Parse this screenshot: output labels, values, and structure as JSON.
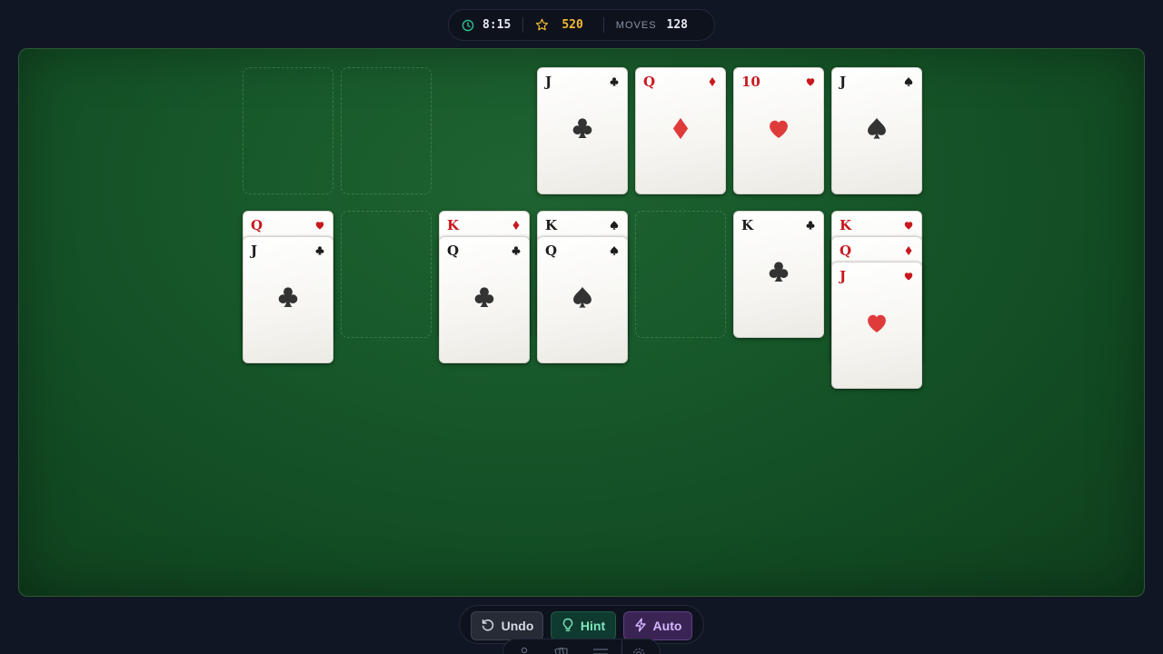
{
  "header": {
    "timer_icon": "clock-icon",
    "timer": "8:15",
    "score_icon": "star-icon",
    "score": "520",
    "moves_label": "MOVES",
    "moves": "128"
  },
  "colors": {
    "felt": "#185a2b",
    "red_suit": "#c8191f",
    "black_suit": "#1d1d1d",
    "score": "#f4b934",
    "hint": "#7de7bd",
    "auto": "#d6b6ff"
  },
  "free_cells": [
    "empty",
    "empty"
  ],
  "foundations": [
    {
      "rank": "J",
      "suit": "clubs"
    },
    {
      "rank": "Q",
      "suit": "diamonds"
    },
    {
      "rank": "10",
      "suit": "hearts"
    },
    {
      "rank": "J",
      "suit": "spades"
    }
  ],
  "tableau": [
    [
      {
        "rank": "Q",
        "suit": "hearts"
      },
      {
        "rank": "J",
        "suit": "clubs"
      }
    ],
    [],
    [
      {
        "rank": "K",
        "suit": "diamonds"
      },
      {
        "rank": "Q",
        "suit": "clubs"
      }
    ],
    [
      {
        "rank": "K",
        "suit": "spades"
      },
      {
        "rank": "Q",
        "suit": "spades"
      }
    ],
    [],
    [
      {
        "rank": "K",
        "suit": "clubs"
      }
    ],
    [
      {
        "rank": "K",
        "suit": "hearts"
      },
      {
        "rank": "Q",
        "suit": "diamonds"
      },
      {
        "rank": "J",
        "suit": "hearts"
      }
    ]
  ],
  "controls": {
    "undo": {
      "label": "Undo",
      "icon": "undo-icon"
    },
    "hint": {
      "label": "Hint",
      "icon": "lightbulb-icon"
    },
    "auto": {
      "label": "Auto",
      "icon": "lightning-icon"
    }
  },
  "secondary_controls": [
    "person-icon",
    "cards-icon",
    "menu-icon",
    "gear-icon"
  ]
}
